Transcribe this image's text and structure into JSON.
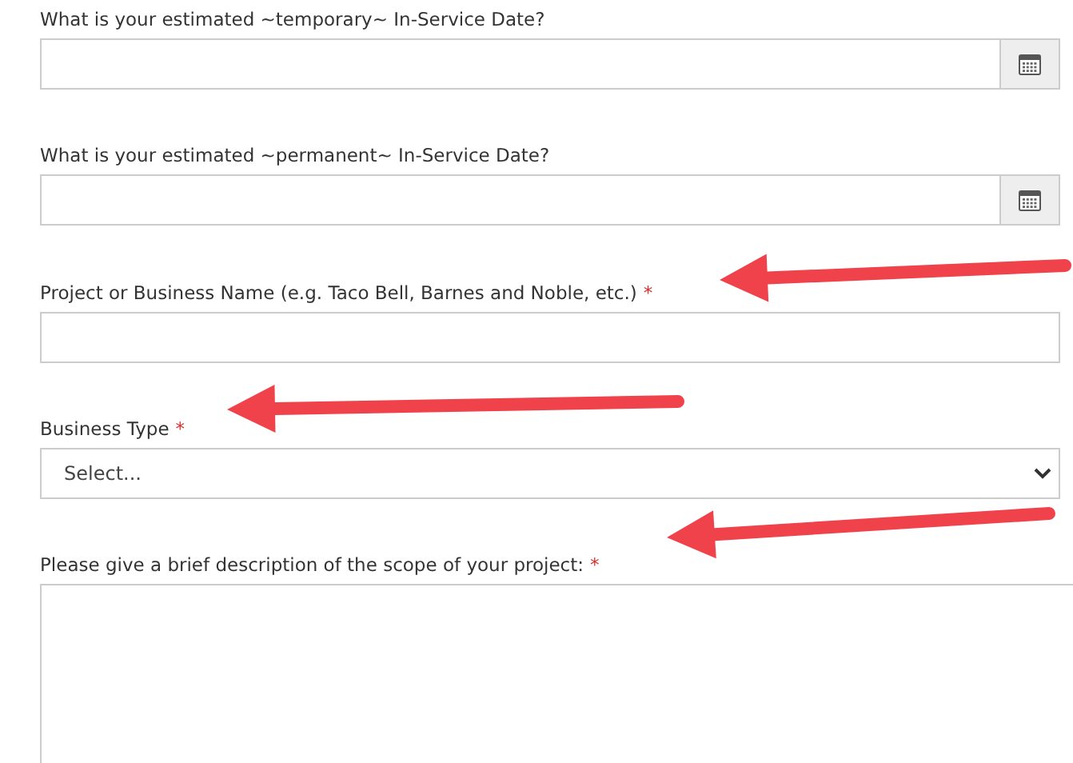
{
  "fields": [
    {
      "kind": "date",
      "label": "What is your estimated ~temporary~ In-Service Date?",
      "required": false
    },
    {
      "kind": "date",
      "label": "What is your estimated ~permanent~ In-Service Date?",
      "required": false
    },
    {
      "kind": "text",
      "label": "Project or Business Name (e.g. Taco Bell, Barnes and Noble, etc.)",
      "required": true
    },
    {
      "kind": "select",
      "label": "Business Type",
      "required": true,
      "value": "Select..."
    },
    {
      "kind": "textarea",
      "label": "Please give a brief description of the scope of your project:",
      "required": true
    }
  ],
  "required_mark": "*"
}
